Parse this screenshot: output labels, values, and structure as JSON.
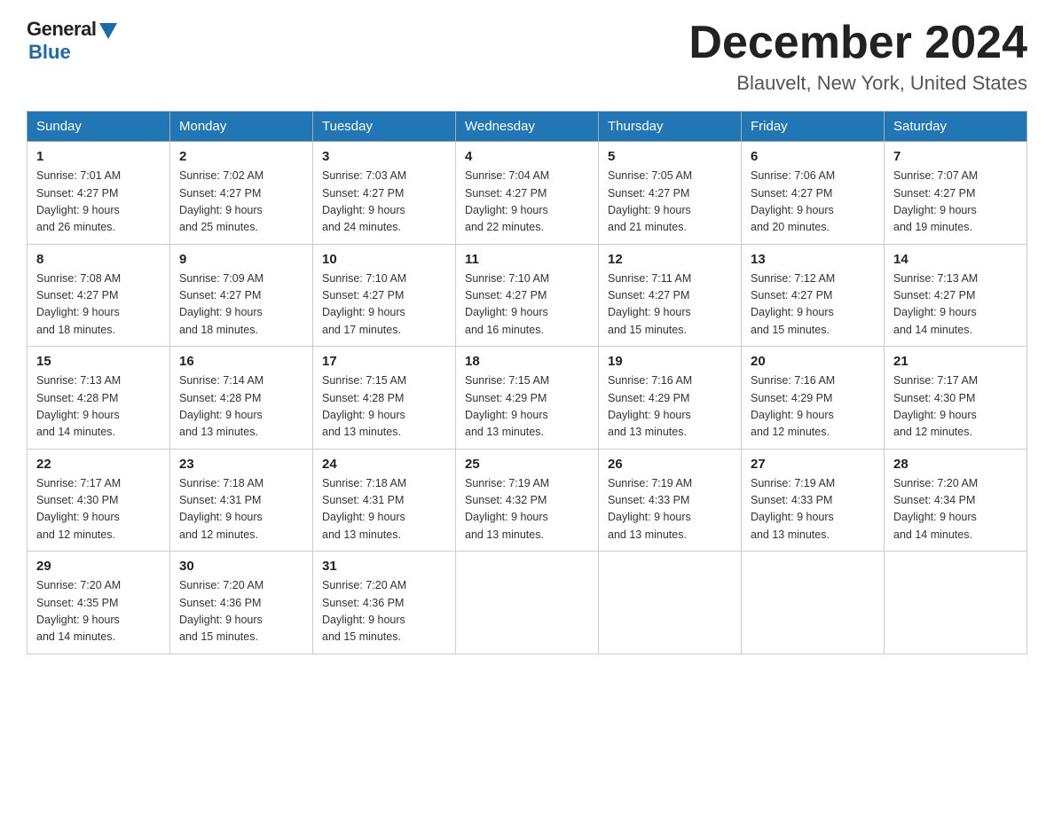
{
  "header": {
    "logo_general": "General",
    "logo_blue": "Blue",
    "month_title": "December 2024",
    "location": "Blauvelt, New York, United States"
  },
  "days_of_week": [
    "Sunday",
    "Monday",
    "Tuesday",
    "Wednesday",
    "Thursday",
    "Friday",
    "Saturday"
  ],
  "weeks": [
    [
      {
        "day": "1",
        "sunrise": "7:01 AM",
        "sunset": "4:27 PM",
        "daylight": "9 hours and 26 minutes."
      },
      {
        "day": "2",
        "sunrise": "7:02 AM",
        "sunset": "4:27 PM",
        "daylight": "9 hours and 25 minutes."
      },
      {
        "day": "3",
        "sunrise": "7:03 AM",
        "sunset": "4:27 PM",
        "daylight": "9 hours and 24 minutes."
      },
      {
        "day": "4",
        "sunrise": "7:04 AM",
        "sunset": "4:27 PM",
        "daylight": "9 hours and 22 minutes."
      },
      {
        "day": "5",
        "sunrise": "7:05 AM",
        "sunset": "4:27 PM",
        "daylight": "9 hours and 21 minutes."
      },
      {
        "day": "6",
        "sunrise": "7:06 AM",
        "sunset": "4:27 PM",
        "daylight": "9 hours and 20 minutes."
      },
      {
        "day": "7",
        "sunrise": "7:07 AM",
        "sunset": "4:27 PM",
        "daylight": "9 hours and 19 minutes."
      }
    ],
    [
      {
        "day": "8",
        "sunrise": "7:08 AM",
        "sunset": "4:27 PM",
        "daylight": "9 hours and 18 minutes."
      },
      {
        "day": "9",
        "sunrise": "7:09 AM",
        "sunset": "4:27 PM",
        "daylight": "9 hours and 18 minutes."
      },
      {
        "day": "10",
        "sunrise": "7:10 AM",
        "sunset": "4:27 PM",
        "daylight": "9 hours and 17 minutes."
      },
      {
        "day": "11",
        "sunrise": "7:10 AM",
        "sunset": "4:27 PM",
        "daylight": "9 hours and 16 minutes."
      },
      {
        "day": "12",
        "sunrise": "7:11 AM",
        "sunset": "4:27 PM",
        "daylight": "9 hours and 15 minutes."
      },
      {
        "day": "13",
        "sunrise": "7:12 AM",
        "sunset": "4:27 PM",
        "daylight": "9 hours and 15 minutes."
      },
      {
        "day": "14",
        "sunrise": "7:13 AM",
        "sunset": "4:27 PM",
        "daylight": "9 hours and 14 minutes."
      }
    ],
    [
      {
        "day": "15",
        "sunrise": "7:13 AM",
        "sunset": "4:28 PM",
        "daylight": "9 hours and 14 minutes."
      },
      {
        "day": "16",
        "sunrise": "7:14 AM",
        "sunset": "4:28 PM",
        "daylight": "9 hours and 13 minutes."
      },
      {
        "day": "17",
        "sunrise": "7:15 AM",
        "sunset": "4:28 PM",
        "daylight": "9 hours and 13 minutes."
      },
      {
        "day": "18",
        "sunrise": "7:15 AM",
        "sunset": "4:29 PM",
        "daylight": "9 hours and 13 minutes."
      },
      {
        "day": "19",
        "sunrise": "7:16 AM",
        "sunset": "4:29 PM",
        "daylight": "9 hours and 13 minutes."
      },
      {
        "day": "20",
        "sunrise": "7:16 AM",
        "sunset": "4:29 PM",
        "daylight": "9 hours and 12 minutes."
      },
      {
        "day": "21",
        "sunrise": "7:17 AM",
        "sunset": "4:30 PM",
        "daylight": "9 hours and 12 minutes."
      }
    ],
    [
      {
        "day": "22",
        "sunrise": "7:17 AM",
        "sunset": "4:30 PM",
        "daylight": "9 hours and 12 minutes."
      },
      {
        "day": "23",
        "sunrise": "7:18 AM",
        "sunset": "4:31 PM",
        "daylight": "9 hours and 12 minutes."
      },
      {
        "day": "24",
        "sunrise": "7:18 AM",
        "sunset": "4:31 PM",
        "daylight": "9 hours and 13 minutes."
      },
      {
        "day": "25",
        "sunrise": "7:19 AM",
        "sunset": "4:32 PM",
        "daylight": "9 hours and 13 minutes."
      },
      {
        "day": "26",
        "sunrise": "7:19 AM",
        "sunset": "4:33 PM",
        "daylight": "9 hours and 13 minutes."
      },
      {
        "day": "27",
        "sunrise": "7:19 AM",
        "sunset": "4:33 PM",
        "daylight": "9 hours and 13 minutes."
      },
      {
        "day": "28",
        "sunrise": "7:20 AM",
        "sunset": "4:34 PM",
        "daylight": "9 hours and 14 minutes."
      }
    ],
    [
      {
        "day": "29",
        "sunrise": "7:20 AM",
        "sunset": "4:35 PM",
        "daylight": "9 hours and 14 minutes."
      },
      {
        "day": "30",
        "sunrise": "7:20 AM",
        "sunset": "4:36 PM",
        "daylight": "9 hours and 15 minutes."
      },
      {
        "day": "31",
        "sunrise": "7:20 AM",
        "sunset": "4:36 PM",
        "daylight": "9 hours and 15 minutes."
      },
      null,
      null,
      null,
      null
    ]
  ],
  "labels": {
    "sunrise": "Sunrise:",
    "sunset": "Sunset:",
    "daylight": "Daylight:"
  }
}
